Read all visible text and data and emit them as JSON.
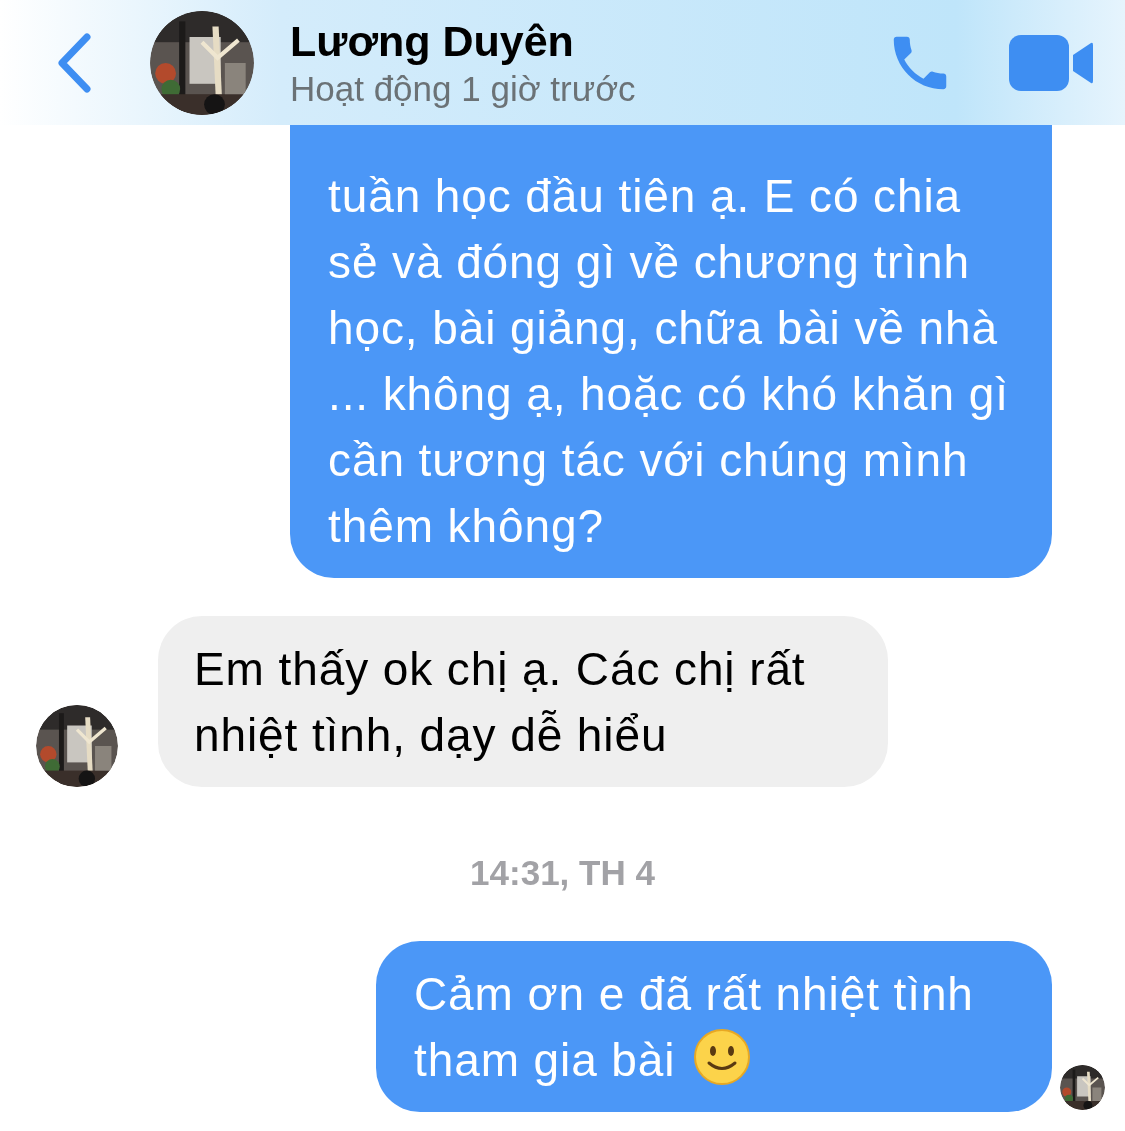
{
  "header": {
    "contact_name": "Lương Duyên",
    "status": "Hoạt động 1 giờ trước"
  },
  "messages": [
    {
      "kind": "sent",
      "text": "tuần học đầu tiên ạ. E có chia sẻ và đóng gì về chương trình học, bài giảng, chữa bài về nhà ... không ạ, hoặc có khó khăn gì cần tương tác với chúng mình thêm không?",
      "cut_top": true,
      "emoji": false
    },
    {
      "kind": "received",
      "text": "Em thấy ok chị ạ. Các chị rất nhiệt tình, dạy dễ hiểu"
    },
    {
      "kind": "timestamp",
      "text": "14:31, TH 4"
    },
    {
      "kind": "sent",
      "text": "Cảm ơn e đã rất nhiệt tình tham gia bài",
      "cut_top": false,
      "emoji": true
    }
  ]
}
